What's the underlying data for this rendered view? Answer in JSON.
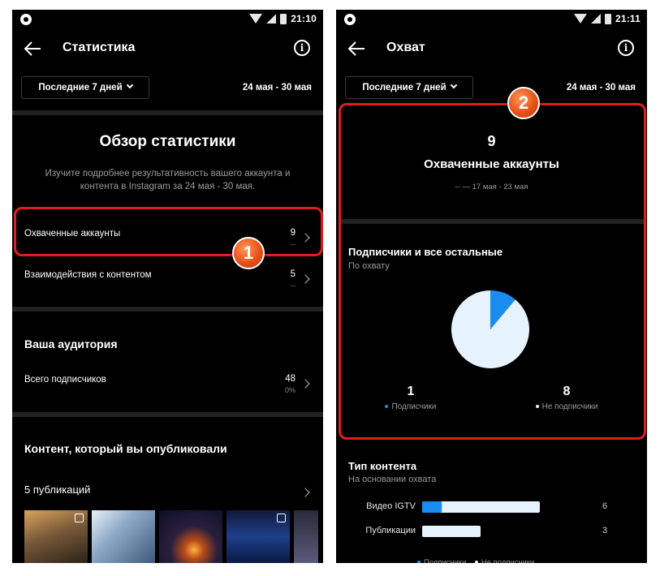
{
  "colors": {
    "background": "#000000",
    "divider": "#222222",
    "accent_blue": "#1a8cf0",
    "light_blue": "#e6f2fd",
    "highlight_red": "#e01e1e",
    "callout_orange": "#e8501a"
  },
  "left_screen": {
    "status": {
      "time": "21:10"
    },
    "header": {
      "title": "Статистика"
    },
    "filter": {
      "period": "Последние 7 дней",
      "date_range": "24 мая - 30 мая"
    },
    "overview": {
      "title": "Обзор статистики",
      "description": "Изучите подробнее результативность вашего аккаунта и контента в Instagram за 24 мая - 30 мая."
    },
    "rows": [
      {
        "label": "Охваченные аккаунты",
        "value": "9",
        "sub": "--"
      },
      {
        "label": "Взаимодействия с контентом",
        "value": "5",
        "sub": "--"
      }
    ],
    "audience": {
      "heading": "Ваша аудитория",
      "total_label": "Всего подписчиков",
      "total_value": "48",
      "total_sub": "0%"
    },
    "content": {
      "heading": "Контент, который вы опубликовали",
      "publications": "5 публикаций"
    },
    "callout": "1"
  },
  "right_screen": {
    "status": {
      "time": "21:11"
    },
    "header": {
      "title": "Охват"
    },
    "filter": {
      "period": "Последние 7 дней",
      "date_range": "24 мая - 30 мая"
    },
    "reach": {
      "value": "9",
      "title": "Охваченные аккаунты",
      "comparison": "-- — 17 мая - 23 мая"
    },
    "followers_section": {
      "heading": "Подписчики и все остальные",
      "caption": "По охвату"
    },
    "chart_data": {
      "type": "pie",
      "categories": [
        "Подписчики",
        "Не подписчики"
      ],
      "values": [
        1,
        8
      ],
      "colors": [
        "#1a8cf0",
        "#e6f2fd"
      ]
    },
    "legend": {
      "followers_value": "1",
      "followers_label": "Подписчики",
      "non_followers_value": "8",
      "non_followers_label": "Не подписчики"
    },
    "content_type": {
      "heading": "Тип контента",
      "caption": "На основании охвата",
      "bars": [
        {
          "label": "Видео IGTV",
          "value": "6",
          "followers_share": 0.167
        },
        {
          "label": "Публикации",
          "value": "3",
          "followers_share": 0
        }
      ]
    },
    "callout": "2"
  }
}
